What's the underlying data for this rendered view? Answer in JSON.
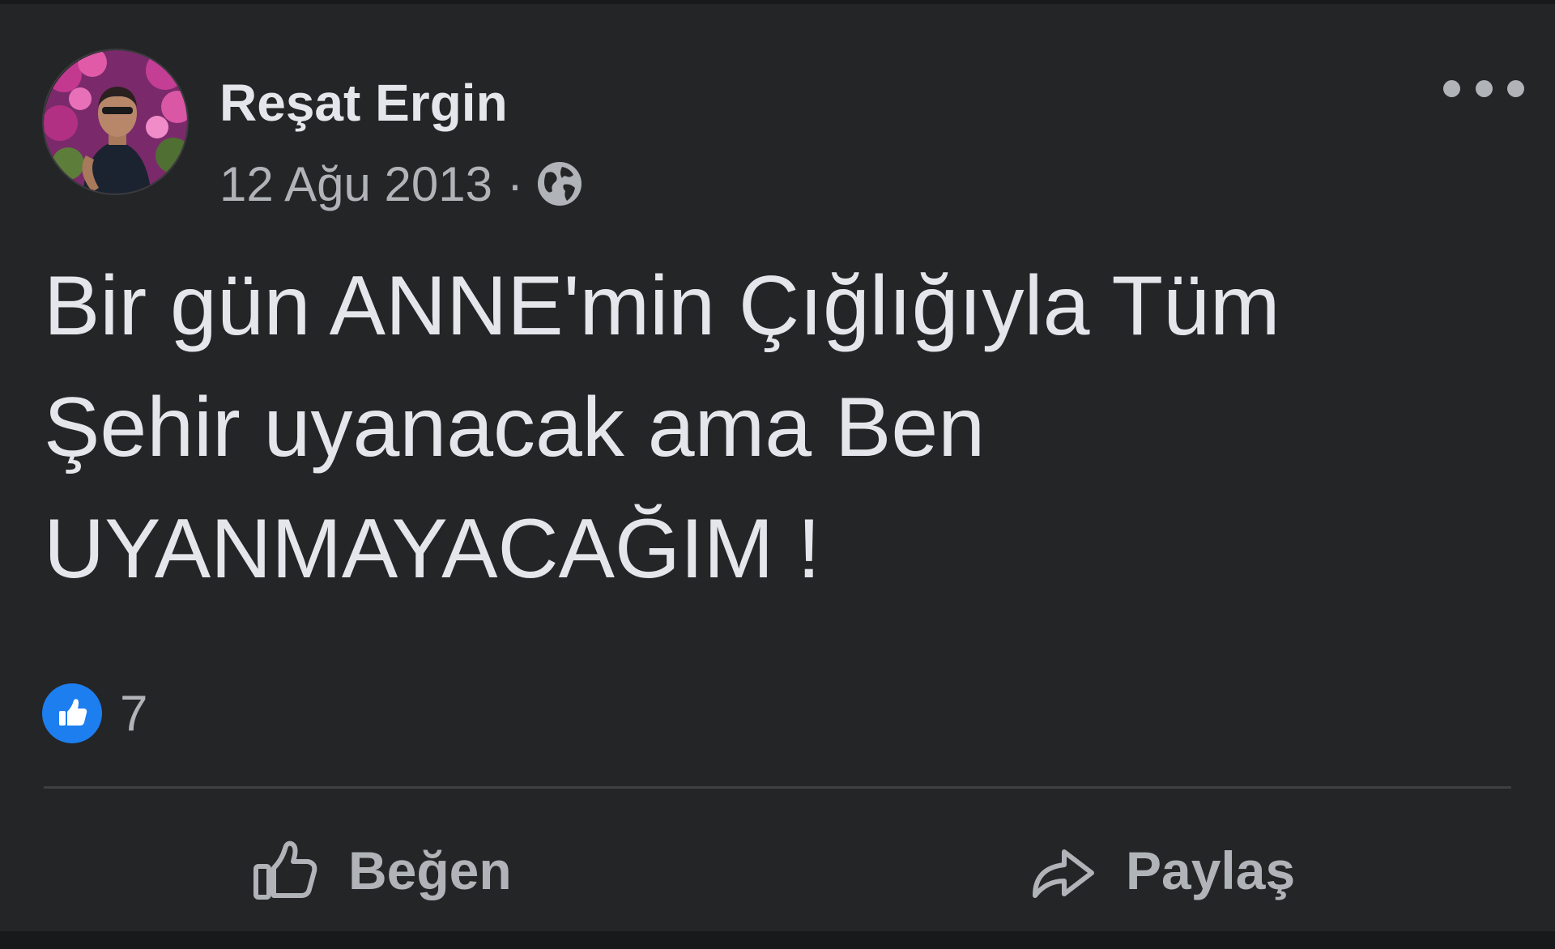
{
  "post": {
    "author": {
      "name": "Reşat Ergin",
      "avatar_icon": "profile-photo-icon"
    },
    "date": "12 Ağu 2013",
    "separator": "·",
    "privacy_icon": "globe-icon",
    "text_lines": [
      "Bir gün ANNE'min Çığlığıyla Tüm",
      "Şehir uyanacak ama Ben",
      "UYANMAYACAĞIM !"
    ],
    "reactions": {
      "icon": "like-reaction-icon",
      "count": "7"
    },
    "actions": {
      "like_label": "Beğen",
      "share_label": "Paylaş"
    },
    "more_icon": "more-options-icon"
  },
  "colors": {
    "background": "#242526",
    "text_primary": "#e4e6eb",
    "text_secondary": "#b0b3b8",
    "like_blue": "#1d7ef0",
    "divider": "#3e4042"
  }
}
